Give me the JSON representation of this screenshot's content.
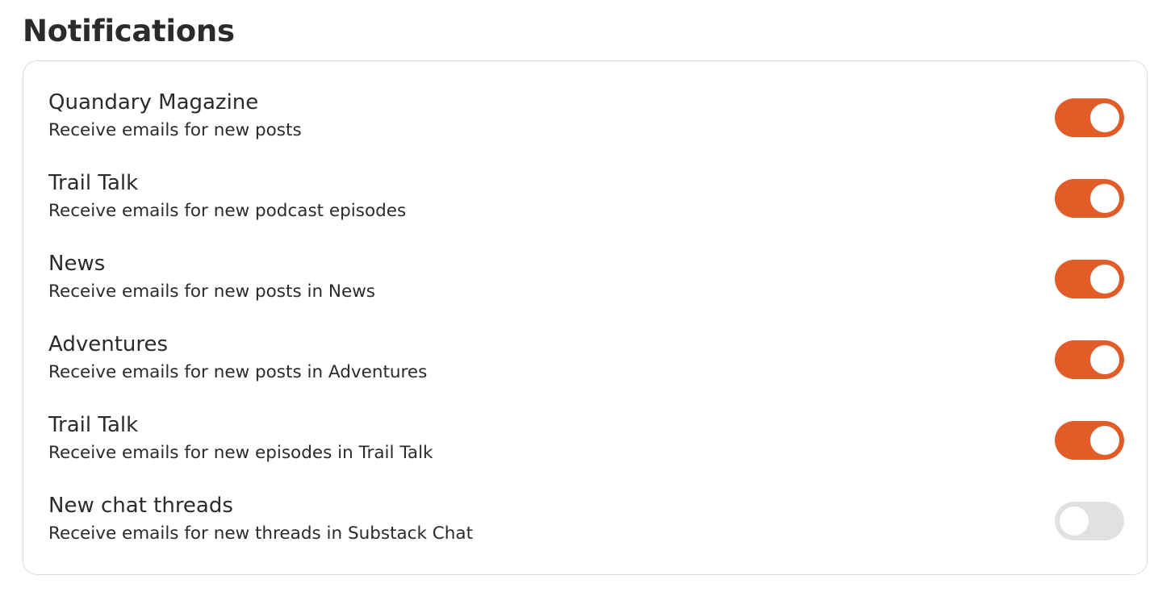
{
  "page": {
    "title": "Notifications"
  },
  "colors": {
    "accent": "#e25c28",
    "toggle_off": "#e1e1e1",
    "border": "#dcdcdc",
    "text": "#2b2b2b"
  },
  "notifications": [
    {
      "title": "Quandary Magazine",
      "description": "Receive emails for new posts",
      "enabled": true
    },
    {
      "title": "Trail Talk",
      "description": "Receive emails for new podcast episodes",
      "enabled": true
    },
    {
      "title": "News",
      "description": "Receive emails for new posts in News",
      "enabled": true
    },
    {
      "title": "Adventures",
      "description": "Receive emails for new posts in Adventures",
      "enabled": true
    },
    {
      "title": "Trail Talk",
      "description": "Receive emails for new episodes in Trail Talk",
      "enabled": true
    },
    {
      "title": "New chat threads",
      "description": "Receive emails for new threads in Substack Chat",
      "enabled": false
    }
  ]
}
